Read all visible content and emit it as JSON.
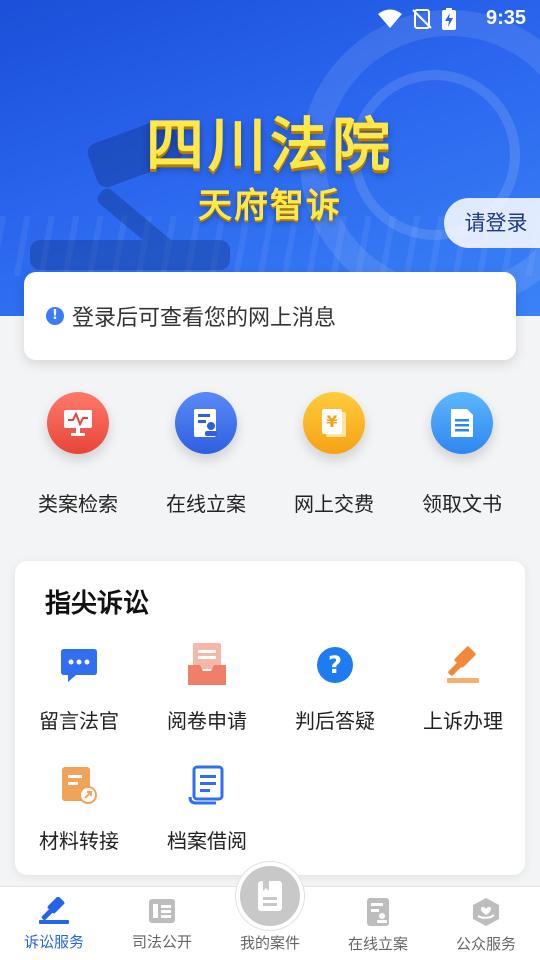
{
  "status": {
    "time": "9:35"
  },
  "banner": {
    "title": "四川法院",
    "subtitle": "天府智诉",
    "login": "请登录"
  },
  "message": {
    "text": "登录后可查看您的网上消息"
  },
  "quick": [
    {
      "label": "类案检索",
      "icon": "monitor-chart-icon",
      "color": "#f0554a"
    },
    {
      "label": "在线立案",
      "icon": "document-user-icon",
      "color": "#3a6ff0"
    },
    {
      "label": "网上交费",
      "icon": "yuan-receipt-icon",
      "color": "#f6b01a"
    },
    {
      "label": "领取文书",
      "icon": "document-lines-icon",
      "color": "#3a9cf5"
    }
  ],
  "fingertip": {
    "title": "指尖诉讼",
    "items": [
      {
        "label": "留言法官",
        "icon": "chat-bubble-icon"
      },
      {
        "label": "阅卷申请",
        "icon": "inbox-document-icon"
      },
      {
        "label": "判后答疑",
        "icon": "question-circle-icon"
      },
      {
        "label": "上诉办理",
        "icon": "gavel-icon"
      },
      {
        "label": "材料转接",
        "icon": "document-transfer-icon"
      },
      {
        "label": "档案借阅",
        "icon": "scroll-document-icon"
      }
    ]
  },
  "nav": [
    {
      "label": "诉讼服务",
      "icon": "gavel-nav-icon",
      "active": true
    },
    {
      "label": "司法公开",
      "icon": "list-nav-icon",
      "active": false
    },
    {
      "label": "我的案件",
      "icon": "book-nav-icon",
      "active": false
    },
    {
      "label": "在线立案",
      "icon": "file-user-nav-icon",
      "active": false
    },
    {
      "label": "公众服务",
      "icon": "hand-heart-nav-icon",
      "active": false
    }
  ]
}
